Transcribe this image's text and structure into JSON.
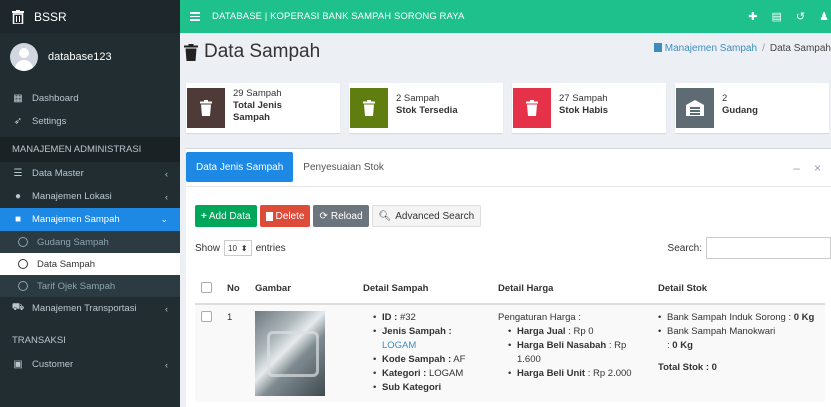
{
  "app": {
    "name": "BSSR"
  },
  "user": {
    "name": "database123"
  },
  "sidebar": {
    "top_items": [
      {
        "label": "Dashboard"
      },
      {
        "label": "Settings"
      }
    ],
    "header_admin": "MANAJEMEN ADMINISTRASI",
    "admin_items": [
      {
        "label": "Data Master"
      },
      {
        "label": "Manajemen Lokasi"
      },
      {
        "label": "Manajemen Sampah"
      }
    ],
    "sampah_sub": [
      {
        "label": "Gudang Sampah"
      },
      {
        "label": "Data Sampah"
      },
      {
        "label": "Tarif Ojek Sampah"
      }
    ],
    "transport_item": {
      "label": "Manajemen Transportasi"
    },
    "header_transaksi": "TRANSAKSI",
    "transaksi_items": [
      {
        "label": "Customer"
      }
    ]
  },
  "topbar": {
    "title": "DATABASE | KOPERASI BANK SAMPAH SORONG RAYA"
  },
  "page": {
    "title": "Data Sampah",
    "breadcrumb": {
      "parent": "Manajemen Sampah",
      "current": "Data Sampah"
    }
  },
  "cards": [
    {
      "line1": "29 Sampah",
      "line2": "Total Jenis",
      "line3": "Sampah",
      "color": "#4e3b37"
    },
    {
      "line1": "2 Sampah",
      "line2": "Stok Tersedia",
      "line3": "",
      "color": "#607d10"
    },
    {
      "line1": "27 Sampah",
      "line2": "Stok Habis",
      "line3": "",
      "color": "#e53248"
    },
    {
      "line1": "2",
      "line2": "Gudang",
      "line3": "",
      "color": "#5f6b73"
    }
  ],
  "tabs": [
    {
      "label": "Data Jenis Sampah"
    },
    {
      "label": "Penyesuaian Stok"
    }
  ],
  "buttons": {
    "add": "Add Data",
    "delete": "Delete",
    "reload": "Reload",
    "search": "Advanced Search"
  },
  "table_controls": {
    "show": "Show",
    "entries_value": "10",
    "entries": "entries",
    "search_label": "Search:"
  },
  "table": {
    "headers": [
      "No",
      "Gambar",
      "Detail Sampah",
      "Detail Harga",
      "Detail Stok"
    ],
    "row": {
      "no": "1",
      "detail_sampah": {
        "id_label": "ID :",
        "id_value": "#32",
        "jenis_label": "Jenis Sampah :",
        "jenis_value": "LOGAM",
        "kode_label": "Kode Sampah :",
        "kode_value": "AF",
        "kategori_label": "Kategori :",
        "kategori_value": "LOGAM",
        "sub_label": "Sub Kategori"
      },
      "detail_harga": {
        "heading": "Pengaturan Harga :",
        "jual_label": "Harga Jual",
        "jual_value": ": Rp 0",
        "beli_nasabah_label": "Harga Beli Nasabah",
        "beli_nasabah_value": ": Rp 1.600",
        "beli_unit_label": "Harga Beli Unit",
        "beli_unit_value": ": Rp 2.000"
      },
      "detail_stok": {
        "induk_label": "Bank Sampah Induk Sorong :",
        "induk_value": "0 Kg",
        "manokwari_label": "Bank Sampah Manokwari",
        "manokwari_value": "0 Kg",
        "total_label": "Total Stok :",
        "total_value": "0"
      }
    }
  }
}
